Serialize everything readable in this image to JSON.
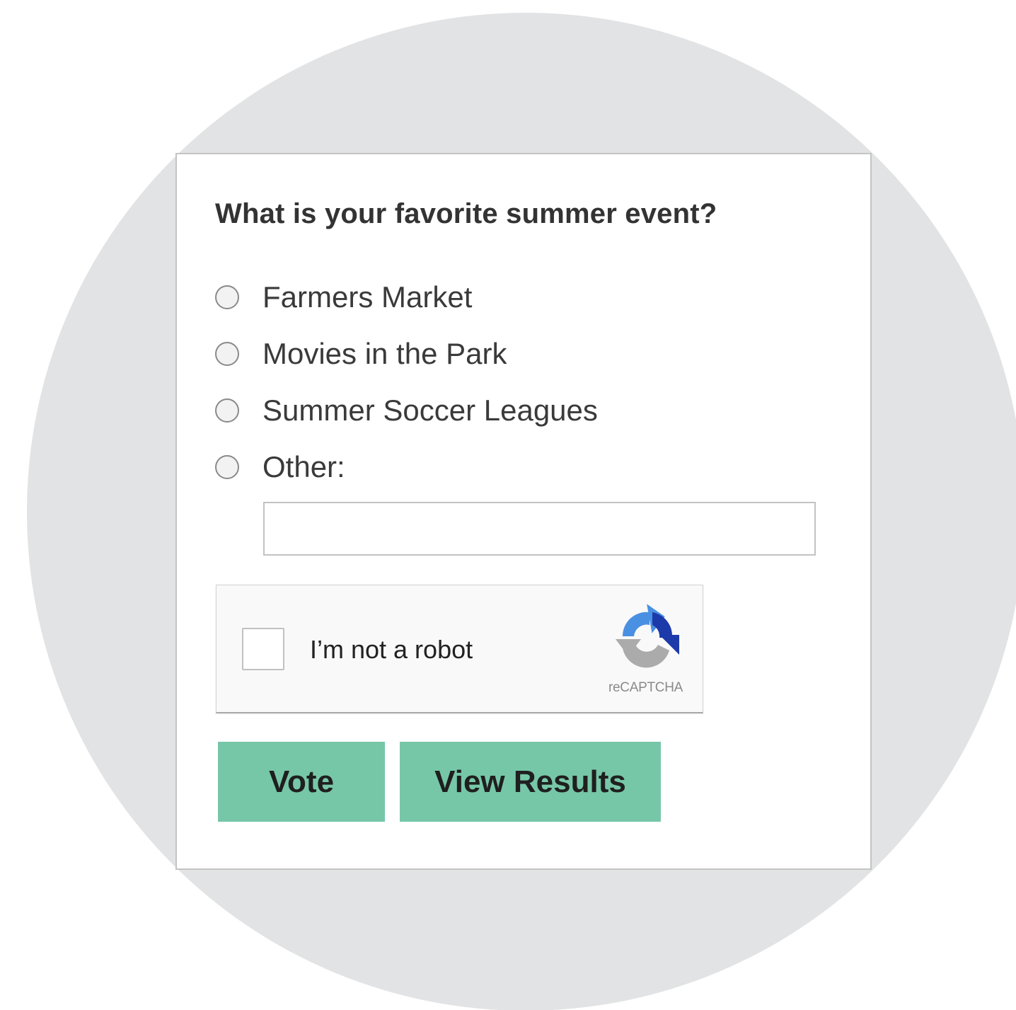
{
  "poll": {
    "question": "What is your favorite summer event?",
    "options": [
      {
        "label": "Farmers Market",
        "selected": false
      },
      {
        "label": "Movies in the Park",
        "selected": false
      },
      {
        "label": "Summer Soccer Leagues",
        "selected": false
      },
      {
        "label": "Other:",
        "selected": false
      }
    ],
    "other_input": {
      "value": "",
      "placeholder": ""
    }
  },
  "captcha": {
    "checked": false,
    "label": "I’m not a robot",
    "brand": "reCAPTCHA",
    "logo_icon": "recaptcha-logo-icon"
  },
  "actions": {
    "vote_label": "Vote",
    "view_results_label": "View Results"
  },
  "colors": {
    "background_circle": "#e2e3e4",
    "button_fill": "#76c7a8",
    "recaptcha_blue_dark": "#1c3aa9",
    "recaptcha_blue_light": "#4a90e2",
    "recaptcha_gray": "#ababab"
  }
}
